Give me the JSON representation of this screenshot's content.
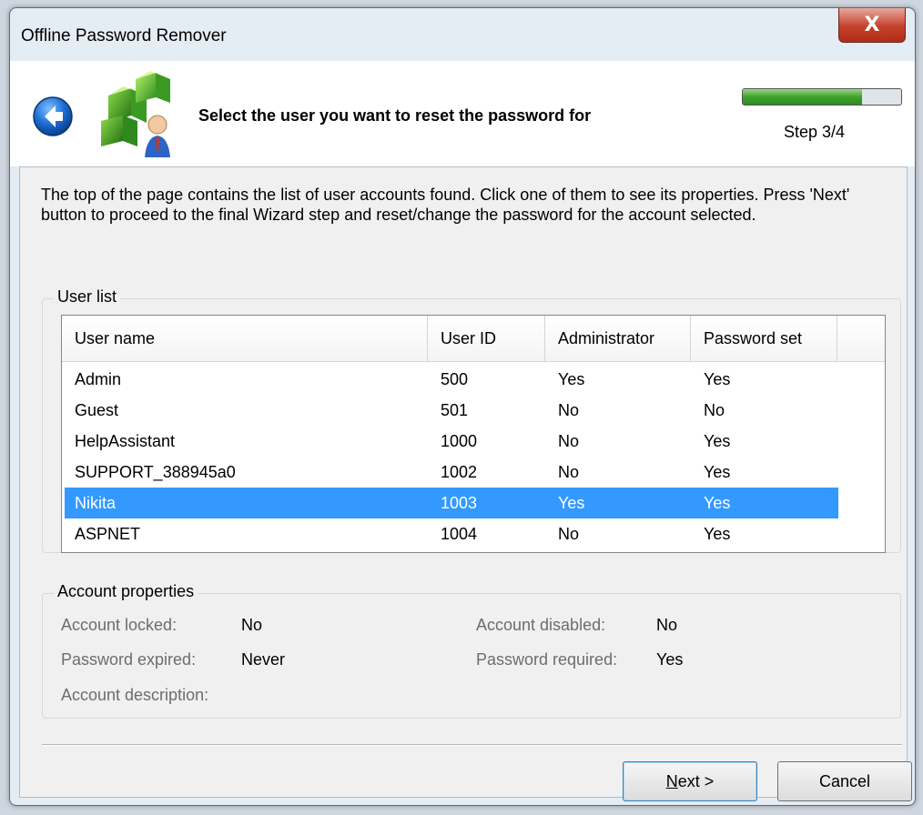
{
  "window": {
    "title": "Offline Password Remover",
    "close_glyph": "X"
  },
  "header": {
    "title": "Select the user you want to reset the password for",
    "step_label": "Step 3/4",
    "progress_fraction": 0.75,
    "back_icon": "back-arrow-icon",
    "logo_icon": "cubes-user-logo"
  },
  "description": "The top of the page contains the list of user accounts found. Click one of them to see its properties. Press 'Next' button to proceed to the final Wizard step and reset/change the password for the account selected.",
  "user_list": {
    "label": "User list",
    "columns": [
      "User name",
      "User ID",
      "Administrator",
      "Password set"
    ],
    "rows": [
      [
        "Admin",
        "500",
        "Yes",
        "Yes"
      ],
      [
        "Guest",
        "501",
        "No",
        "No"
      ],
      [
        "HelpAssistant",
        "1000",
        "No",
        "Yes"
      ],
      [
        "SUPPORT_388945a0",
        "1002",
        "No",
        "Yes"
      ],
      [
        "Nikita",
        "1003",
        "Yes",
        "Yes"
      ],
      [
        "ASPNET",
        "1004",
        "No",
        "Yes"
      ]
    ],
    "selected_index": 4,
    "selection_color": "#3399ff"
  },
  "account_properties": {
    "label": "Account properties",
    "locked_label": "Account locked:",
    "locked_value": "No",
    "disabled_label": "Account disabled:",
    "disabled_value": "No",
    "expired_label": "Password expired:",
    "expired_value": "Never",
    "required_label": "Password required:",
    "required_value": "Yes",
    "description_label": "Account description:",
    "description_value": ""
  },
  "buttons": {
    "next_label": "Next >",
    "cancel_label": "Cancel"
  }
}
